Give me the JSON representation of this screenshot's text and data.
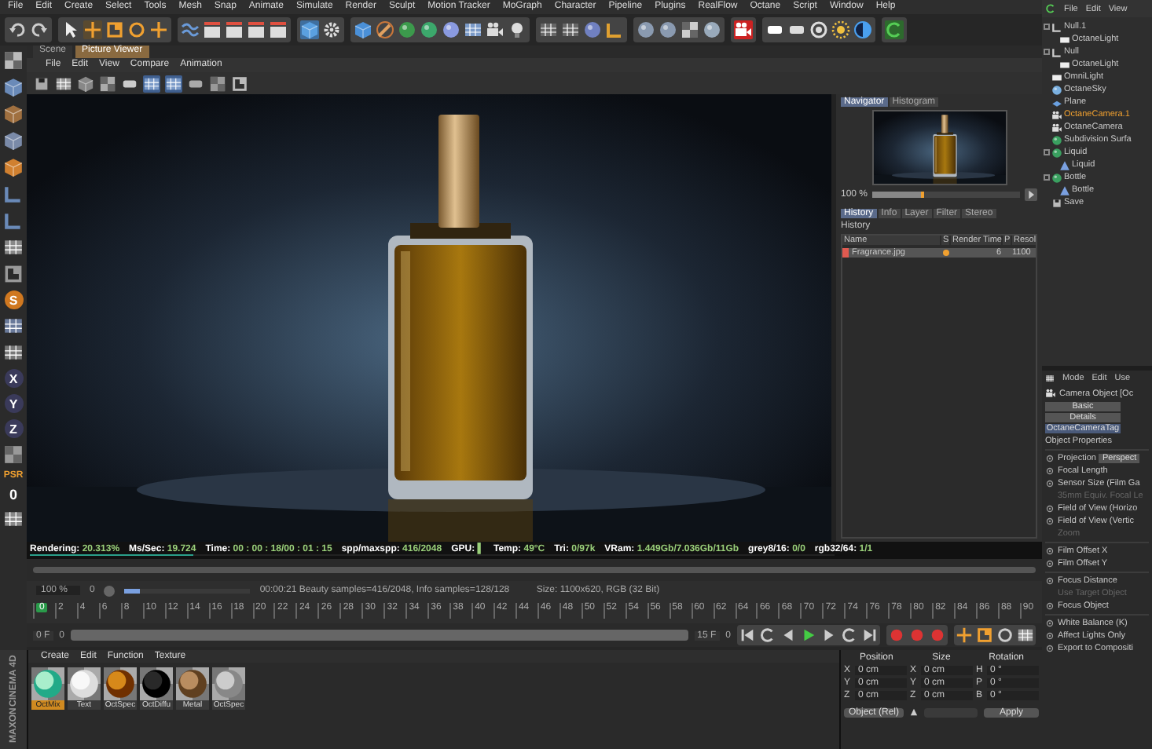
{
  "menu": [
    "File",
    "Edit",
    "Create",
    "Select",
    "Tools",
    "Mesh",
    "Snap",
    "Animate",
    "Simulate",
    "Render",
    "Sculpt",
    "Motion Tracker",
    "MoGraph",
    "Character",
    "Pipeline",
    "Plugins",
    "RealFlow",
    "Octane",
    "Script",
    "Window",
    "Help"
  ],
  "side_tools": {
    "snap": "S",
    "axes": [
      "X",
      "Y",
      "Z"
    ],
    "psr": "PSR",
    "psr_value": "0"
  },
  "viewer": {
    "tabs": [
      {
        "label": "Scene",
        "selected": false
      },
      {
        "label": "Picture Viewer",
        "selected": true
      }
    ],
    "menu": [
      "File",
      "Edit",
      "View",
      "Compare",
      "Animation"
    ]
  },
  "navigator": {
    "tabs": [
      {
        "label": "Navigator",
        "selected": true
      },
      {
        "label": "Histogram",
        "selected": false
      }
    ],
    "zoom": "100 %",
    "level": 0.35
  },
  "history": {
    "tabs": [
      {
        "label": "History",
        "selected": true
      },
      {
        "label": "Info",
        "selected": false
      },
      {
        "label": "Layer",
        "selected": false
      },
      {
        "label": "Filter",
        "selected": false
      },
      {
        "label": "Stereo",
        "selected": false
      }
    ],
    "title": "History",
    "columns": [
      "Name",
      "S",
      "Render Time",
      "P",
      "Resol"
    ],
    "rows": [
      {
        "name": "Fragrance.jpg",
        "color": "#e05a50",
        "render_time": "6",
        "resolution": "1100",
        "selected": true
      }
    ]
  },
  "status": {
    "level": 0.203,
    "items": [
      {
        "label": "Rendering:",
        "value": "20.313%"
      },
      {
        "label": "Ms/Sec:",
        "value": "19.724"
      },
      {
        "label": "Time:",
        "value": "00 : 00 : 18/00 : 01 : 15"
      },
      {
        "label": "spp/maxspp:",
        "value": "416/2048"
      },
      {
        "label": "GPU:",
        "value": "▌"
      },
      {
        "label": "Temp:",
        "value": "49°C"
      },
      {
        "label": "Tri:",
        "value": "0/97k"
      },
      {
        "label": "VRam:",
        "value": "1.449Gb/7.036Gb/11Gb"
      },
      {
        "label": "grey8/16:",
        "value": "0/0"
      },
      {
        "label": "rgb32/64:",
        "value": "1/1"
      }
    ]
  },
  "info": {
    "level": 0.12,
    "zoom": "100 %",
    "frame": "0",
    "message": "00:00:21 Beauty samples=416/2048, Info samples=128/128",
    "size": "Size: 1100x620, RGB (32 Bit)"
  },
  "timeline": {
    "ticks": [
      "0",
      "2",
      "4",
      "6",
      "8",
      "10",
      "12",
      "14",
      "16",
      "18",
      "20",
      "22",
      "24",
      "26",
      "28",
      "30",
      "32",
      "34",
      "36",
      "38",
      "40",
      "42",
      "44",
      "46",
      "48",
      "50",
      "52",
      "54",
      "56",
      "58",
      "60",
      "62",
      "64",
      "66",
      "68",
      "70",
      "72",
      "74",
      "76",
      "78",
      "80",
      "82",
      "84",
      "86",
      "88",
      "90"
    ]
  },
  "range": {
    "level": 1,
    "start": "0 F",
    "start_step": "0",
    "end": "15 F",
    "end_step": "0"
  },
  "brand": [
    "MAXON",
    "CINEMA 4D"
  ],
  "materials": {
    "menu": [
      "Create",
      "Edit",
      "Function",
      "Texture"
    ],
    "items": [
      {
        "label": "OctMix",
        "kind": "mix",
        "selected": true
      },
      {
        "label": "Text",
        "kind": "white",
        "selected": false
      },
      {
        "label": "OctSpec",
        "kind": "spec",
        "selected": false
      },
      {
        "label": "OctDiffu",
        "kind": "black",
        "selected": false
      },
      {
        "label": "Metal",
        "kind": "metal",
        "selected": false
      },
      {
        "label": "OctSpec",
        "kind": "glass",
        "selected": false
      }
    ]
  },
  "coordinates": {
    "headers": [
      "Position",
      "Size",
      "Rotation"
    ],
    "rows": [
      {
        "axis": "X",
        "position": "0 cm",
        "size_axis": "X",
        "size": "0 cm",
        "rotation_axis": "H",
        "rotation": "0 °"
      },
      {
        "axis": "Y",
        "position": "0 cm",
        "size_axis": "Y",
        "size": "0 cm",
        "rotation_axis": "P",
        "rotation": "0 °"
      },
      {
        "axis": "Z",
        "position": "0 cm",
        "size_axis": "Z",
        "size": "0 cm",
        "rotation_axis": "B",
        "rotation": "0 °"
      }
    ],
    "mode": "Object (Rel)",
    "apply": "Apply"
  },
  "objects": {
    "menu": [
      "File",
      "Edit",
      "View"
    ],
    "tree": [
      {
        "label": "Null.1",
        "kind": "null",
        "selected": false,
        "children": [
          {
            "label": "OctaneLight",
            "kind": "light",
            "selected": false
          }
        ]
      },
      {
        "label": "Null",
        "kind": "null",
        "selected": false,
        "children": [
          {
            "label": "OctaneLight",
            "kind": "light",
            "selected": false
          }
        ]
      },
      {
        "label": "OmniLight",
        "kind": "light",
        "selected": false
      },
      {
        "label": "OctaneSky",
        "kind": "sky",
        "selected": false
      },
      {
        "label": "Plane",
        "kind": "plane",
        "selected": false
      },
      {
        "label": "OctaneCamera.1",
        "kind": "camera",
        "selected": true
      },
      {
        "label": "OctaneCamera",
        "kind": "camera",
        "selected": false
      },
      {
        "label": "Subdivision Surfa",
        "kind": "generator",
        "selected": false
      },
      {
        "label": "Liquid",
        "kind": "generator",
        "selected": false,
        "children": [
          {
            "label": "Liquid",
            "kind": "mesh",
            "selected": false
          }
        ]
      },
      {
        "label": "Bottle",
        "kind": "generator",
        "selected": false,
        "children": [
          {
            "label": "Bottle",
            "kind": "mesh",
            "selected": false
          }
        ]
      },
      {
        "label": "Save",
        "kind": "save",
        "selected": false
      }
    ]
  },
  "attributes": {
    "menu": [
      "Mode",
      "Edit",
      "Use"
    ],
    "title": "Camera Object [Oc",
    "tabs": [
      {
        "label": "Basic",
        "selected": false
      },
      {
        "label": "Details",
        "selected": false
      },
      {
        "label": "OctaneCameraTag",
        "selected": true
      }
    ],
    "section": "Object Properties",
    "groups": [
      [
        {
          "label": "Projection",
          "kind": "dropdown",
          "value": "Perspect",
          "disabled": false
        },
        {
          "label": "Focal Length",
          "kind": "field",
          "disabled": false
        },
        {
          "label": "Sensor Size (Film Ga",
          "kind": "field",
          "disabled": false
        },
        {
          "label": "35mm Equiv. Focal Le",
          "kind": "field",
          "disabled": true
        },
        {
          "label": "Field of View (Horizo",
          "kind": "field",
          "disabled": false
        },
        {
          "label": "Field of View (Vertic",
          "kind": "field",
          "disabled": false
        },
        {
          "label": "Zoom",
          "kind": "field",
          "disabled": true
        }
      ],
      [
        {
          "label": "Film Offset X",
          "kind": "field",
          "disabled": false
        },
        {
          "label": "Film Offset Y",
          "kind": "field",
          "disabled": false
        }
      ],
      [
        {
          "label": "Focus Distance",
          "kind": "field",
          "disabled": false
        },
        {
          "label": "Use Target Object",
          "kind": "field",
          "disabled": true
        },
        {
          "label": "Focus Object",
          "kind": "field",
          "disabled": false
        }
      ],
      [
        {
          "label": "White Balance (K)",
          "kind": "field",
          "disabled": false
        },
        {
          "label": "Affect Lights Only",
          "kind": "field",
          "disabled": false
        },
        {
          "label": "Export to Compositi",
          "kind": "field",
          "disabled": false
        }
      ]
    ]
  }
}
